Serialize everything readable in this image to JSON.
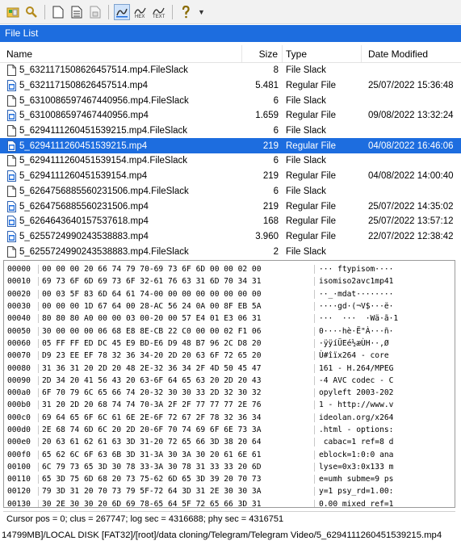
{
  "toolbar": {
    "icons": [
      "partition-icon",
      "search-icon",
      "new-document-icon",
      "properties-icon",
      "save-icon",
      "file-view-icon",
      "hex-view-icon",
      "text-view-icon",
      "help-icon",
      "dropdown-arrow-icon"
    ],
    "colors": {
      "accent": "#1d6ddf"
    }
  },
  "file_list": {
    "title": "File List",
    "columns": {
      "name": "Name",
      "size": "Size",
      "type": "Type",
      "date": "Date Modified"
    },
    "rows": [
      {
        "name": "5_6321171508626457514.mp4.FileSlack",
        "size": "8",
        "type": "File Slack",
        "date": "",
        "icon": "slack-file-icon",
        "selected": false
      },
      {
        "name": "5_6321171508626457514.mp4",
        "size": "5.481",
        "type": "Regular File",
        "date": "25/07/2022 15:36:48",
        "icon": "video-file-icon",
        "selected": false
      },
      {
        "name": "5_6310086597467440956.mp4.FileSlack",
        "size": "6",
        "type": "File Slack",
        "date": "",
        "icon": "slack-file-icon",
        "selected": false
      },
      {
        "name": "5_6310086597467440956.mp4",
        "size": "1.659",
        "type": "Regular File",
        "date": "09/08/2022 13:32:24",
        "icon": "video-file-icon",
        "selected": false
      },
      {
        "name": "5_6294111260451539215.mp4.FileSlack",
        "size": "6",
        "type": "File Slack",
        "date": "",
        "icon": "slack-file-icon",
        "selected": false
      },
      {
        "name": "5_6294111260451539215.mp4",
        "size": "219",
        "type": "Regular File",
        "date": "04/08/2022 16:46:06",
        "icon": "video-file-icon",
        "selected": true
      },
      {
        "name": "5_6294111260451539154.mp4.FileSlack",
        "size": "6",
        "type": "File Slack",
        "date": "",
        "icon": "slack-file-icon",
        "selected": false
      },
      {
        "name": "5_6294111260451539154.mp4",
        "size": "219",
        "type": "Regular File",
        "date": "04/08/2022 14:00:40",
        "icon": "video-file-icon",
        "selected": false
      },
      {
        "name": "5_6264756885560231506.mp4.FileSlack",
        "size": "6",
        "type": "File Slack",
        "date": "",
        "icon": "slack-file-icon",
        "selected": false
      },
      {
        "name": "5_6264756885560231506.mp4",
        "size": "219",
        "type": "Regular File",
        "date": "25/07/2022 14:35:02",
        "icon": "video-file-icon",
        "selected": false
      },
      {
        "name": "5_6264643640157537618.mp4",
        "size": "168",
        "type": "Regular File",
        "date": "25/07/2022 13:57:12",
        "icon": "video-file-icon",
        "selected": false
      },
      {
        "name": "5_6255724990243538883.mp4",
        "size": "3.960",
        "type": "Regular File",
        "date": "22/07/2022 12:38:42",
        "icon": "video-file-icon",
        "selected": false
      },
      {
        "name": "5_6255724990243538883.mp4.FileSlack",
        "size": "2",
        "type": "File Slack",
        "date": "",
        "icon": "slack-file-icon",
        "selected": false
      }
    ]
  },
  "hex_view": {
    "lines": [
      {
        "offset": "00000",
        "bytes": "00 00 00 20 66 74 79 70-69 73 6F 6D 00 00 02 00",
        "ascii": "··· ftypisom····"
      },
      {
        "offset": "00010",
        "bytes": "69 73 6F 6D 69 73 6F 32-61 76 63 31 6D 70 34 31",
        "ascii": "isomiso2avc1mp41"
      },
      {
        "offset": "00020",
        "bytes": "00 03 5F 83 6D 64 61 74-00 00 00 00 00 00 00 00",
        "ascii": "··_·mdat········"
      },
      {
        "offset": "00030",
        "bytes": "00 00 00 1D 67 64 00 28-AC 56 24 0A 00 8F EB 5A",
        "ascii": "····gd·(¬V$···ë·"
      },
      {
        "offset": "00040",
        "bytes": "80 80 80 A0 00 00 03 00-20 00 57 E4 01 E3 06 31",
        "ascii": "···  ···  ·Wä·ã·1"
      },
      {
        "offset": "00050",
        "bytes": "30 00 00 00 06 68 E8 8E-CB 22 C0 00 00 02 F1 06",
        "ascii": "0····hè·Ë\"À···ñ·"
      },
      {
        "offset": "00060",
        "bytes": "05 FF FF ED DC 45 E9 BD-E6 D9 48 B7 96 2C D8 20",
        "ascii": "·ÿÿíÜEé½æÙH··,Ø "
      },
      {
        "offset": "00070",
        "bytes": "D9 23 EE EF 78 32 36 34-20 2D 20 63 6F 72 65 20",
        "ascii": "Ù#îïx264 - core "
      },
      {
        "offset": "00080",
        "bytes": "31 36 31 20 2D 20 48 2E-32 36 34 2F 4D 50 45 47",
        "ascii": "161 - H.264/MPEG"
      },
      {
        "offset": "00090",
        "bytes": "2D 34 20 41 56 43 20 63-6F 64 65 63 20 2D 20 43",
        "ascii": "-4 AVC codec - C"
      },
      {
        "offset": "000a0",
        "bytes": "6F 70 79 6C 65 66 74 20-32 30 30 33 2D 32 30 32",
        "ascii": "opyleft 2003-202"
      },
      {
        "offset": "000b0",
        "bytes": "31 20 2D 20 68 74 74 70-3A 2F 2F 77 77 77 2E 76",
        "ascii": "1 - http://www.v"
      },
      {
        "offset": "000c0",
        "bytes": "69 64 65 6F 6C 61 6E 2E-6F 72 67 2F 78 32 36 34",
        "ascii": "ideolan.org/x264"
      },
      {
        "offset": "000d0",
        "bytes": "2E 68 74 6D 6C 20 2D 20-6F 70 74 69 6F 6E 73 3A",
        "ascii": ".html - options:"
      },
      {
        "offset": "000e0",
        "bytes": "20 63 61 62 61 63 3D 31-20 72 65 66 3D 38 20 64",
        "ascii": " cabac=1 ref=8 d"
      },
      {
        "offset": "000f0",
        "bytes": "65 62 6C 6F 63 6B 3D 31-3A 30 3A 30 20 61 6E 61",
        "ascii": "eblock=1:0:0 ana"
      },
      {
        "offset": "00100",
        "bytes": "6C 79 73 65 3D 30 78 33-3A 30 78 31 33 33 20 6D",
        "ascii": "lyse=0x3:0x133 m"
      },
      {
        "offset": "00110",
        "bytes": "65 3D 75 6D 68 20 73 75-62 6D 65 3D 39 20 70 73",
        "ascii": "e=umh subme=9 ps"
      },
      {
        "offset": "00120",
        "bytes": "79 3D 31 20 70 73 79 5F-72 64 3D 31 2E 30 30 3A",
        "ascii": "y=1 psy_rd=1.00:"
      },
      {
        "offset": "00130",
        "bytes": "30 2E 30 30 20 6D 69 78-65 64 5F 72 65 66 3D 31",
        "ascii": "0.00 mixed_ref=1"
      }
    ]
  },
  "status": {
    "cursor_info": "Cursor pos = 0; clus = 267747; log sec = 4316688; phy sec = 4316751"
  },
  "path": "14799MB]/LOCAL DISK [FAT32]/[root]/data cloning/Telegram/Telegram Video/5_6294111260451539215.mp4"
}
